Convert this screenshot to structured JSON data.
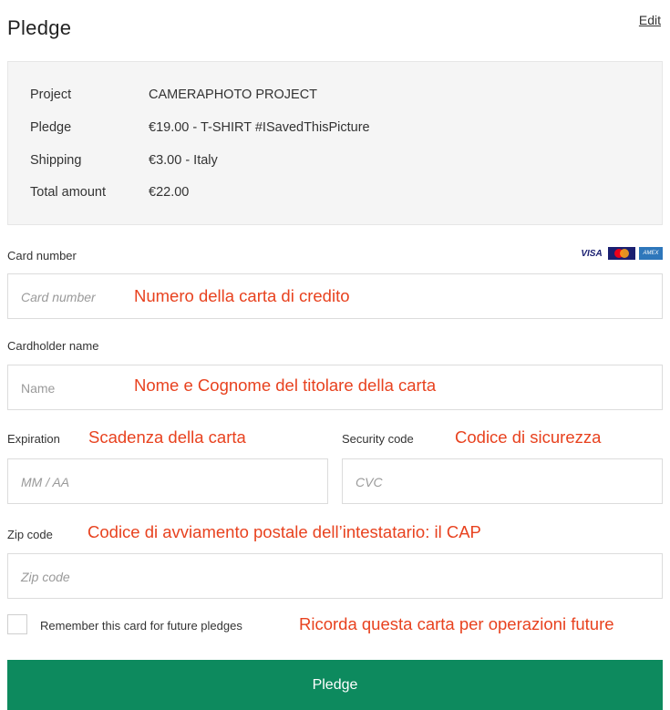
{
  "header": {
    "title": "Pledge",
    "edit_label": "Edit"
  },
  "summary": {
    "rows": [
      {
        "label": "Project",
        "value": "CAMERAPHOTO PROJECT"
      },
      {
        "label": "Pledge",
        "value": "€19.00 - T-SHIRT #ISavedThisPicture"
      },
      {
        "label": "Shipping",
        "value": "€3.00 - Italy"
      },
      {
        "label": "Total amount",
        "value": "€22.00"
      }
    ]
  },
  "card_logos": {
    "visa": "VISA",
    "mastercard_icon": "mastercard-icon",
    "amex": "AMEX"
  },
  "form": {
    "card_number": {
      "label": "Card number",
      "placeholder": "Card number",
      "annotation": "Numero della carta di credito"
    },
    "cardholder": {
      "label": "Cardholder name",
      "placeholder": "Name",
      "annotation": "Nome e Cognome del titolare della carta"
    },
    "expiration": {
      "label": "Expiration",
      "placeholder": "MM / AA",
      "annotation": "Scadenza della carta"
    },
    "security": {
      "label": "Security code",
      "placeholder": "CVC",
      "annotation": "Codice di sicurezza"
    },
    "zip": {
      "label": "Zip code",
      "placeholder": "Zip code",
      "annotation": "Codice di avviamento postale dell’intestatario: il CAP"
    },
    "remember": {
      "label": "Remember this card for future pledges",
      "annotation": "Ricorda questa carta per operazioni future"
    }
  },
  "button": {
    "label": "Pledge"
  },
  "colors": {
    "annotation": "#e8421f",
    "button": "#0d8a5e"
  }
}
